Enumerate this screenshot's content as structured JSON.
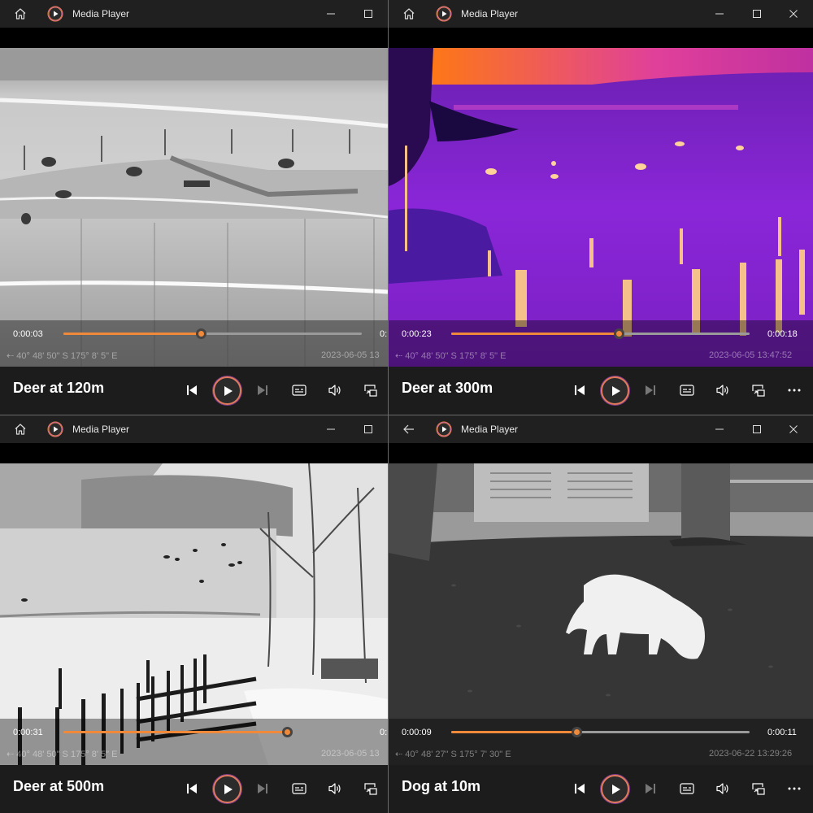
{
  "app": {
    "title": "Media Player",
    "accent": "#f08a3a"
  },
  "windows": [
    {
      "video_title": "Deer at 120m",
      "current_time": "0:00:03",
      "total_time": "0:",
      "progress": 0.46,
      "osd_coords": "40° 48' 50\" S   175° 8' 5\" E",
      "osd_datetime": "2023-06-05 13",
      "nav_icon": "home-icon",
      "palette": "white-hot"
    },
    {
      "video_title": "Deer at 300m",
      "current_time": "0:00:23",
      "total_time": "0:00:18",
      "progress": 0.56,
      "osd_coords": "40° 48' 50\" S   175° 8' 5\" E",
      "osd_datetime": "2023-06-05 13:47:52",
      "nav_icon": "home-icon",
      "palette": "ironbow"
    },
    {
      "video_title": "Deer at 500m",
      "current_time": "0:00:31",
      "total_time": "0:",
      "progress": 0.75,
      "osd_coords": "40° 48' 50\" S   175° 8' 5\" E",
      "osd_datetime": "2023-06-05 13",
      "nav_icon": "home-icon",
      "palette": "white-hot"
    },
    {
      "video_title": "Dog at 10m",
      "current_time": "0:00:09",
      "total_time": "0:00:11",
      "progress": 0.42,
      "osd_coords": "40° 48' 27\" S   175° 7' 30\" E",
      "osd_datetime": "2023-06-22 13:29:26",
      "nav_icon": "back-arrow-icon",
      "palette": "white-hot"
    }
  ],
  "controls": {
    "previous_icon": "skip-previous-icon",
    "play_icon": "play-icon",
    "next_icon": "skip-next-icon",
    "subtitles_icon": "subtitles-icon",
    "volume_icon": "volume-icon",
    "miniplayer_icon": "miniplayer-icon",
    "more_icon": "more-options-icon"
  }
}
